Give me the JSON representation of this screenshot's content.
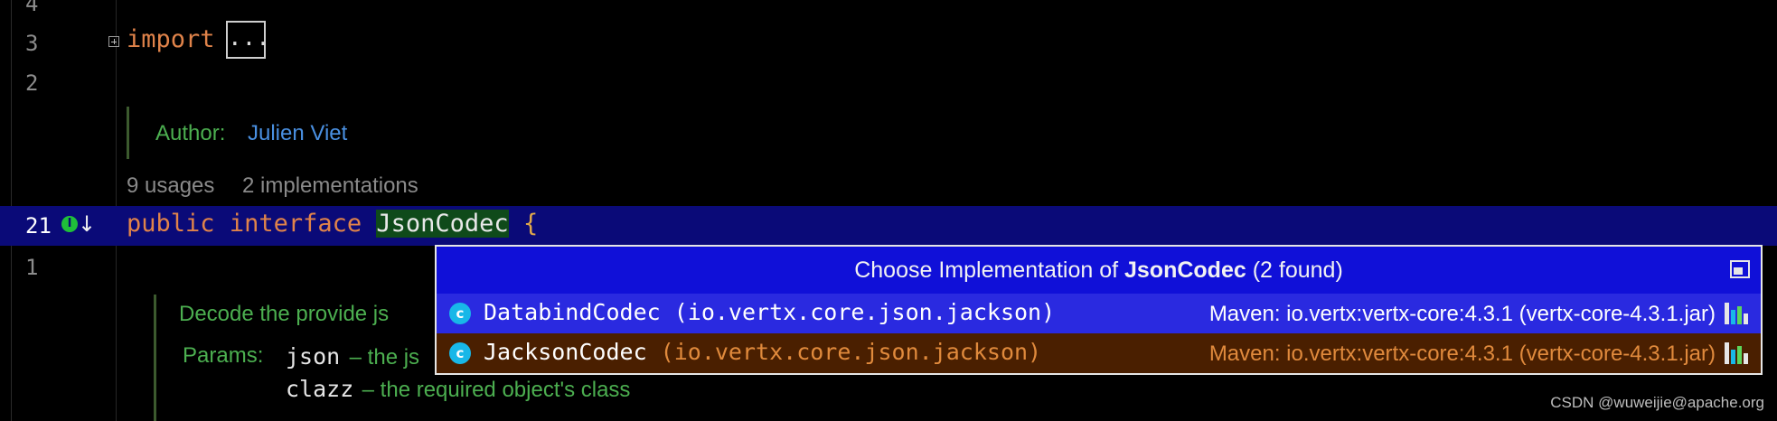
{
  "editor": {
    "line_numbers": [
      "4",
      "3",
      "2",
      "21",
      "1"
    ],
    "import_keyword": "import",
    "import_ellipsis": "...",
    "author_label": "Author:",
    "author_name": "Julien Viet",
    "inlay_usages": "9 usages",
    "inlay_implementations": "2 implementations",
    "decl_public": "public",
    "decl_interface": "interface",
    "decl_name": "JsonCodec",
    "decl_brace": "{",
    "doc_decode": "Decode the provide js",
    "doc_params_label": "Params:",
    "doc_param_json": "json",
    "doc_param_json_desc": " – the js",
    "doc_param_clazz": "clazz",
    "doc_param_clazz_desc": " – the required object's class",
    "gutter_icon_letter": "I"
  },
  "popup": {
    "title_prefix": "Choose Implementation of ",
    "title_name": "JsonCodec",
    "title_suffix": " (2 found)",
    "items": [
      {
        "class_name": "DatabindCodec",
        "package": " (io.vertx.core.json.jackson)",
        "library": "Maven: io.vertx:vertx-core:4.3.1 (vertx-core-4.3.1.jar)",
        "icon": "class-icon"
      },
      {
        "class_name": "JacksonCodec",
        "package": " (io.vertx.core.json.jackson)",
        "library": "Maven: io.vertx:vertx-core:4.3.1 (vertx-core-4.3.1.jar)",
        "icon": "class-icon"
      }
    ]
  },
  "watermark": "CSDN @wuweijie@apache.org",
  "colors": {
    "background": "#000000",
    "keyword": "#e0834a",
    "doc_text": "#4caf50",
    "author_link": "#4a90e2",
    "selection_row": "#0a0a78",
    "popup_header": "#1010d8",
    "popup_selected": "#2a2ae0",
    "popup_alt": "#4a1f00"
  }
}
